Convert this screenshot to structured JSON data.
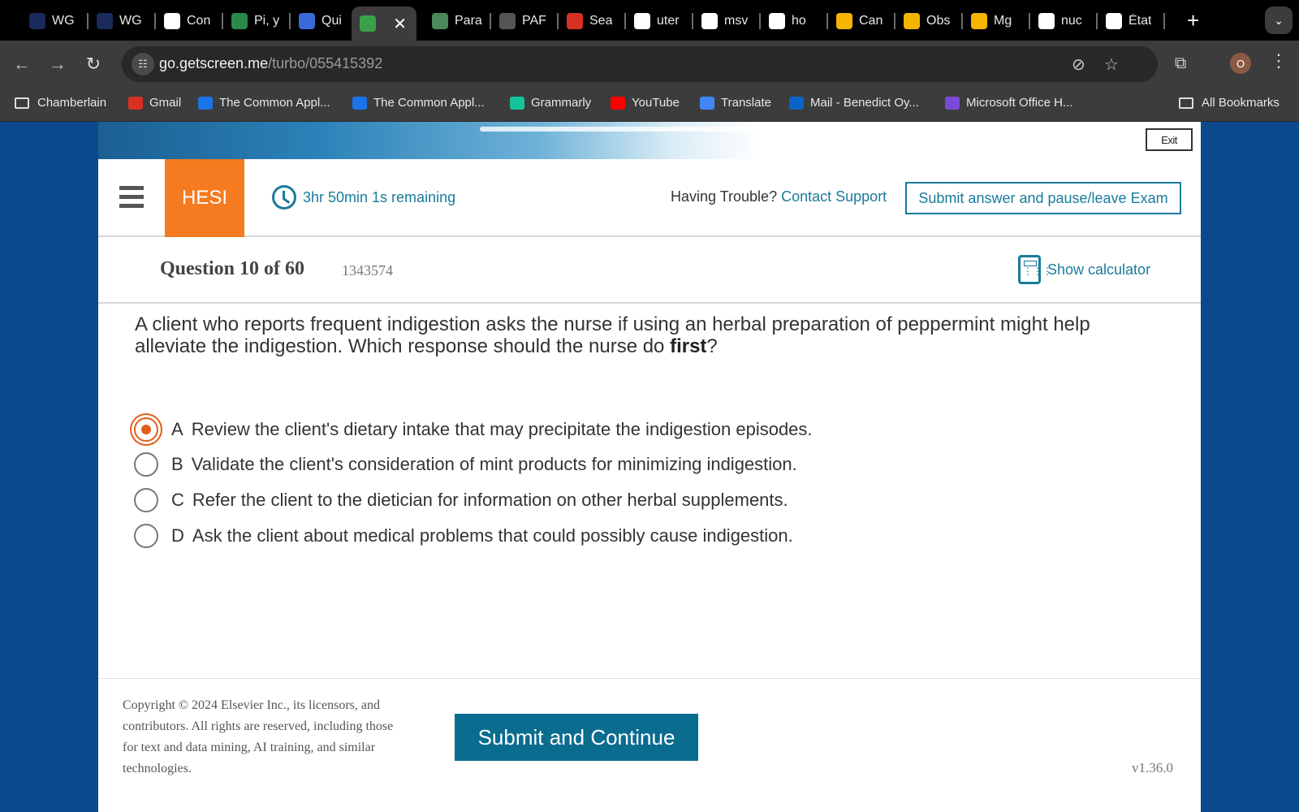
{
  "browser": {
    "tabs": [
      {
        "title": "WG",
        "icon": "wg-icon",
        "color": "#1a2a5a"
      },
      {
        "title": "WG",
        "icon": "wg-icon",
        "color": "#1a2a5a"
      },
      {
        "title": "Con",
        "icon": "openai-icon",
        "color": "#ffffff"
      },
      {
        "title": "Pi, y",
        "icon": "pi-icon",
        "color": "#2a8a4a"
      },
      {
        "title": "Qui",
        "icon": "quizlet-arrow-icon",
        "color": "#3a6ad8"
      },
      {
        "title": "",
        "icon": "active-arrow-icon",
        "color": "#3aa04a",
        "active": true
      },
      {
        "title": "Para",
        "icon": "paraphrase-icon",
        "color": "#4a8a5a"
      },
      {
        "title": "PAF",
        "icon": "paf-icon",
        "color": "#555555"
      },
      {
        "title": "Sea",
        "icon": "gmail-icon",
        "color": "#d93025"
      },
      {
        "title": "uter",
        "icon": "google-icon",
        "color": "#ffffff"
      },
      {
        "title": "msv",
        "icon": "google-icon",
        "color": "#ffffff"
      },
      {
        "title": "ho",
        "icon": "google-icon",
        "color": "#ffffff"
      },
      {
        "title": "Can",
        "icon": "drive-icon",
        "color": "#f4b400"
      },
      {
        "title": "Obs",
        "icon": "drive-icon",
        "color": "#f4b400"
      },
      {
        "title": "Mg",
        "icon": "slides-icon",
        "color": "#f4b400"
      },
      {
        "title": "nuc",
        "icon": "google-icon",
        "color": "#ffffff"
      },
      {
        "title": "État",
        "icon": "openai-icon",
        "color": "#ffffff"
      }
    ],
    "url_host": "go.getscreen.me",
    "url_path": "/turbo/055415392",
    "profile_initial": "O",
    "bookmarks": [
      {
        "label": "Chamberlain",
        "icon": "folder-icon"
      },
      {
        "label": "Gmail",
        "icon": "gmail-icon",
        "color": "#d93025"
      },
      {
        "label": "The Common Appl...",
        "icon": "common-app-icon",
        "color": "#1a73e8"
      },
      {
        "label": "The Common Appl...",
        "icon": "common-app-icon",
        "color": "#1a73e8"
      },
      {
        "label": "Grammarly",
        "icon": "grammarly-icon",
        "color": "#15c39a"
      },
      {
        "label": "YouTube",
        "icon": "youtube-icon",
        "color": "#ff0000"
      },
      {
        "label": "Translate",
        "icon": "translate-icon",
        "color": "#4285f4"
      },
      {
        "label": "Mail - Benedict Oy...",
        "icon": "outlook-icon",
        "color": "#0a64c8"
      },
      {
        "label": "Microsoft Office H...",
        "icon": "office-icon",
        "color": "#7a4ad8"
      }
    ],
    "all_bookmarks": "All Bookmarks"
  },
  "exam": {
    "exit_label": "Exit",
    "logo": "HESI",
    "timer": "3hr 50min 1s remaining",
    "trouble_text": "Having Trouble?",
    "contact_link": "Contact Support",
    "pause_button": "Submit answer and pause/leave Exam",
    "question_number": "Question 10 of 60",
    "question_id": "1343574",
    "calculator_label": "Show calculator",
    "stem_part1": "A client who reports frequent indigestion asks the nurse if using an herbal preparation of peppermint might help alleviate the indigestion. Which response should the nurse do ",
    "stem_bold": "first",
    "stem_end": "?",
    "options": [
      {
        "letter": "A",
        "text": "Review the client's dietary intake that may precipitate the indigestion episodes.",
        "selected": true
      },
      {
        "letter": "B",
        "text": "Validate the client's consideration of mint products for minimizing indigestion.",
        "selected": false
      },
      {
        "letter": "C",
        "text": "Refer the client to the dietician for information on other herbal supplements.",
        "selected": false
      },
      {
        "letter": "D",
        "text": "Ask the client about medical problems that could possibly cause indigestion.",
        "selected": false
      }
    ],
    "copyright": "Copyright © 2024 Elsevier Inc., its licensors, and contributors. All rights are reserved, including those for text and data mining, AI training, and similar technologies.",
    "submit_button": "Submit and Continue",
    "version": "v1.36.0",
    "accent_color": "#1a7b9c",
    "logo_color": "#f47b20"
  }
}
